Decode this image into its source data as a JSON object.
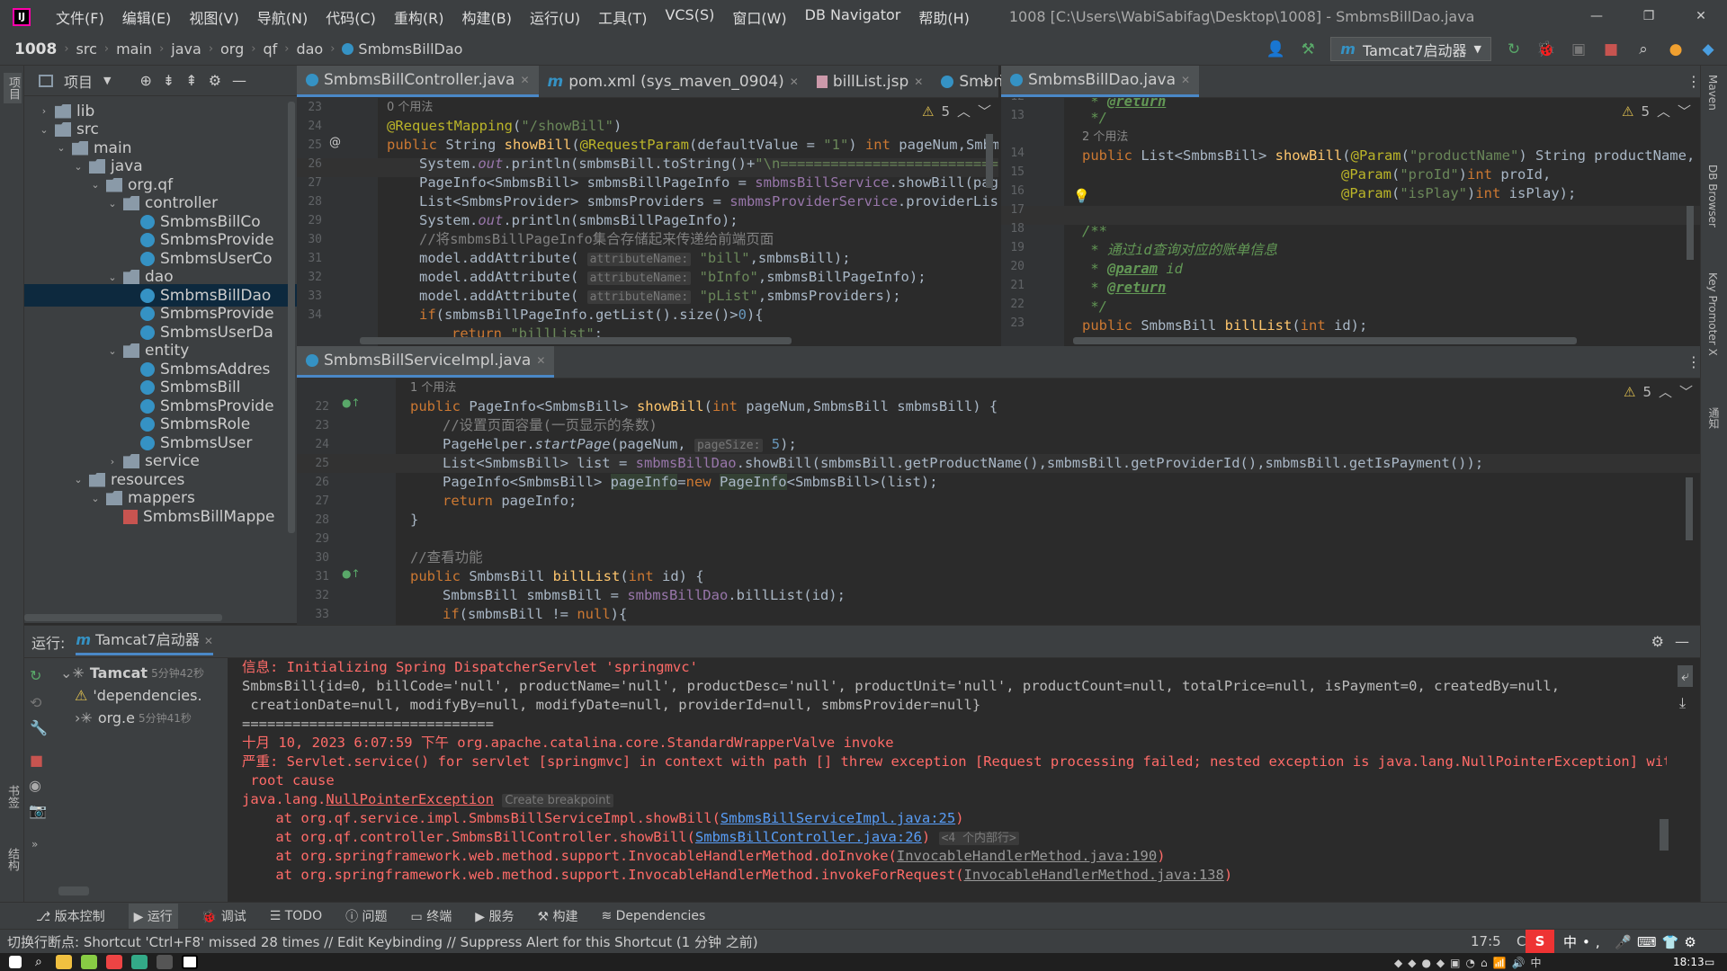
{
  "titlebar": {
    "menu": [
      "文件(F)",
      "编辑(E)",
      "视图(V)",
      "导航(N)",
      "代码(C)",
      "重构(R)",
      "构建(B)",
      "运行(U)",
      "工具(T)",
      "VCS(S)",
      "窗口(W)",
      "DB Navigator",
      "帮助(H)"
    ],
    "window_title": "1008 [C:\\Users\\WabiSabifag\\Desktop\\1008] - SmbmsBillDao.java"
  },
  "breadcrumb": [
    "1008",
    "src",
    "main",
    "java",
    "org",
    "qf",
    "dao",
    "SmbmsBillDao"
  ],
  "run_config": "Tamcat7启动器",
  "project_panel": {
    "title": "项目",
    "tree": [
      {
        "label": "lib",
        "indent": 1,
        "type": "folder",
        "arrow": "›"
      },
      {
        "label": "src",
        "indent": 1,
        "type": "folder",
        "arrow": "⌄"
      },
      {
        "label": "main",
        "indent": 2,
        "type": "folder",
        "arrow": "⌄"
      },
      {
        "label": "java",
        "indent": 3,
        "type": "folder",
        "arrow": "⌄"
      },
      {
        "label": "org.qf",
        "indent": 4,
        "type": "pkg",
        "arrow": "⌄"
      },
      {
        "label": "controller",
        "indent": 5,
        "type": "pkg",
        "arrow": "⌄"
      },
      {
        "label": "SmbmsBillCo",
        "indent": 6,
        "type": "cls",
        "arrow": ""
      },
      {
        "label": "SmbmsProvide",
        "indent": 6,
        "type": "cls",
        "arrow": ""
      },
      {
        "label": "SmbmsUserCo",
        "indent": 6,
        "type": "cls",
        "arrow": ""
      },
      {
        "label": "dao",
        "indent": 5,
        "type": "pkg",
        "arrow": "⌄"
      },
      {
        "label": "SmbmsBillDao",
        "indent": 6,
        "type": "iface",
        "arrow": "",
        "selected": true
      },
      {
        "label": "SmbmsProvide",
        "indent": 6,
        "type": "iface",
        "arrow": ""
      },
      {
        "label": "SmbmsUserDa",
        "indent": 6,
        "type": "iface",
        "arrow": ""
      },
      {
        "label": "entity",
        "indent": 5,
        "type": "pkg",
        "arrow": "⌄"
      },
      {
        "label": "SmbmsAddres",
        "indent": 6,
        "type": "cls",
        "arrow": ""
      },
      {
        "label": "SmbmsBill",
        "indent": 6,
        "type": "cls",
        "arrow": ""
      },
      {
        "label": "SmbmsProvide",
        "indent": 6,
        "type": "cls",
        "arrow": ""
      },
      {
        "label": "SmbmsRole",
        "indent": 6,
        "type": "cls",
        "arrow": ""
      },
      {
        "label": "SmbmsUser",
        "indent": 6,
        "type": "cls",
        "arrow": ""
      },
      {
        "label": "service",
        "indent": 5,
        "type": "pkg",
        "arrow": "›"
      },
      {
        "label": "resources",
        "indent": 3,
        "type": "folder",
        "arrow": "⌄"
      },
      {
        "label": "mappers",
        "indent": 4,
        "type": "folder",
        "arrow": "⌄"
      },
      {
        "label": "SmbmsBillMappe",
        "indent": 5,
        "type": "xml",
        "arrow": ""
      }
    ]
  },
  "tabs_top_left": [
    {
      "label": "SmbmsBillController.java",
      "icon": "class",
      "active": true
    },
    {
      "label": "pom.xml (sys_maven_0904)",
      "icon": "maven"
    },
    {
      "label": "billList.jsp",
      "icon": "jsp"
    },
    {
      "label": "Smbn",
      "icon": "class"
    }
  ],
  "tabs_top_right": [
    {
      "label": "SmbmsBillDao.java",
      "icon": "iface",
      "active": true
    }
  ],
  "tabs_bottom": [
    {
      "label": "SmbmsBillServiceImpl.java",
      "icon": "class",
      "active": true
    }
  ],
  "warnings": {
    "left": "5",
    "right": "5",
    "bottom": "5"
  },
  "editor_left": {
    "usage": "0 个用法",
    "lines": [
      "23",
      "24",
      "25",
      "26",
      "27",
      "28",
      "29",
      "30",
      "31",
      "32",
      "33",
      "34"
    ]
  },
  "editor_right": {
    "usage": "2 个用法",
    "lines": [
      "12",
      "13",
      "",
      "14",
      "15",
      "16",
      "17",
      "18",
      "19",
      "20",
      "21",
      "22",
      "23"
    ]
  },
  "editor_bottom": {
    "usage": "1 个用法",
    "lines": [
      "",
      "22",
      "23",
      "24",
      "25",
      "26",
      "27",
      "28",
      "29",
      "30",
      "31",
      "32",
      "33"
    ]
  },
  "run_panel": {
    "label": "运行:",
    "tab": "Tamcat7启动器",
    "tree": [
      {
        "label": "Tamcat",
        "time": "5分钟42秒"
      },
      {
        "label": "'dependencies.",
        "time": ""
      },
      {
        "label": "org.e",
        "time": "5分钟41秒"
      }
    ]
  },
  "console": {
    "l1": "信息: Initializing Spring DispatcherServlet 'springmvc'",
    "l2": "SmbmsBill{id=0, billCode='null', productName='null', productDesc='null', productUnit='null', productCount=null, totalPrice=null, isPayment=0, createdBy=null,",
    "l3": " creationDate=null, modifyBy=null, modifyDate=null, providerId=null, smbmsProvider=null}",
    "l4": "==============================",
    "l5": "十月 10, 2023 6:07:59 下午 org.apache.catalina.core.StandardWrapperValve invoke",
    "l6": "严重: Servlet.service() for servlet [springmvc] in context with path [] threw exception [Request processing failed; nested exception is java.lang.NullPointerException] with",
    "l7": " root cause",
    "l8a": "java.lang.",
    "l8b": "NullPointerException",
    "l8c": "Create breakpoint",
    "l9a": "    at org.qf.service.impl.SmbmsBillServiceImpl.showBill(",
    "l9b": "SmbmsBillServiceImpl.java:25",
    "l9c": ")",
    "l10a": "    at org.qf.controller.SmbmsBillController.showBill(",
    "l10b": "SmbmsBillController.java:26",
    "l10c": ") ",
    "l10d": "<4 个内部行>",
    "l11a": "    at org.springframework.web.method.support.InvocableHandlerMethod.doInvoke(",
    "l11b": "InvocableHandlerMethod.java:190",
    "l11c": ")",
    "l12a": "    at org.springframework.web.method.support.InvocableHandlerMethod.invokeForRequest(",
    "l12b": "InvocableHandlerMethod.java:138",
    "l12c": ")"
  },
  "bottom_tools": [
    "版本控制",
    "运行",
    "调试",
    "TODO",
    "问题",
    "终端",
    "服务",
    "构建",
    "Dependencies"
  ],
  "status": {
    "message": "切换行断点: Shortcut 'Ctrl+F8' missed 28 times // Edit Keybinding // Suppress Alert for this Shortcut (1 分钟 之前)",
    "position": "17:5",
    "encoding": "CI"
  },
  "right_strip": [
    "Maven",
    "DB Browser",
    "Key Promoter X",
    "通知"
  ],
  "left_strip": [
    "项目",
    "书签",
    "结构"
  ],
  "taskbar": {
    "time": "18:13"
  },
  "colors": {
    "accent": "#4a88c7",
    "error": "#ff6b68",
    "link": "#589df6"
  }
}
